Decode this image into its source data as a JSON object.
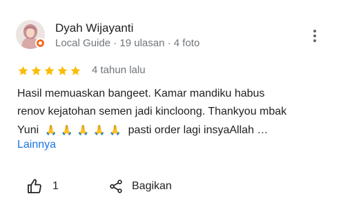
{
  "reviewer": {
    "name": "Dyah Wijayanti",
    "meta": "Local Guide · 19 ulasan · 4 foto"
  },
  "rating": {
    "stars": 5,
    "max": 5,
    "time": "4 tahun lalu"
  },
  "review": {
    "line1": "Hasil memuaskan bangeet. Kamar mandiku habus",
    "line2": "renov kejatohan semen jadi kincloong. Thankyou mbak",
    "line3_start": "Yuni",
    "line3_emoji": "🙏 🙏 🙏 🙏 🙏",
    "line3_end": "pasti order lagi insyaAllah …",
    "more_label": "Lainnya"
  },
  "actions": {
    "like_count": "1",
    "share_label": "Bagikan"
  },
  "icons": {
    "avatar": "reviewer-avatar",
    "badge": "local-guide-badge-icon",
    "menu": "more-vert-icon",
    "star": "star-icon",
    "like": "thumbs-up-icon",
    "share": "share-icon"
  },
  "colors": {
    "star": "#fbbc04",
    "link": "#1a73e8",
    "badge": "#f36c21",
    "secondary_text": "#70757a"
  }
}
